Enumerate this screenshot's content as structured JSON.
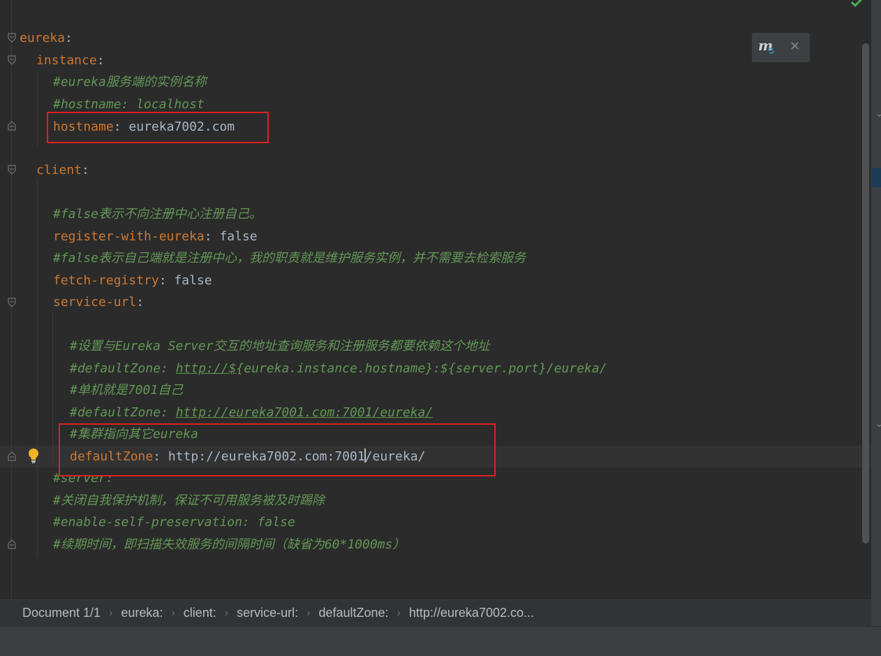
{
  "editor": {
    "lines": [
      {
        "segments": [
          {
            "cls": "k",
            "text": "eureka"
          },
          {
            "cls": "p",
            "text": ":"
          }
        ]
      },
      {
        "segments": [
          {
            "cls": "k",
            "text": "instance"
          },
          {
            "cls": "p",
            "text": ":"
          }
        ]
      },
      {
        "segments": [
          {
            "cls": "c",
            "text": "#eureka服务端的实例名称"
          }
        ]
      },
      {
        "segments": [
          {
            "cls": "c",
            "text": "#hostname: localhost"
          }
        ]
      },
      {
        "segments": [
          {
            "cls": "k",
            "text": "hostname"
          },
          {
            "cls": "p",
            "text": ": "
          },
          {
            "cls": "v",
            "text": "eureka7002.com"
          }
        ]
      },
      {
        "segments": []
      },
      {
        "segments": [
          {
            "cls": "k",
            "text": "client"
          },
          {
            "cls": "p",
            "text": ":"
          }
        ]
      },
      {
        "segments": []
      },
      {
        "segments": [
          {
            "cls": "c",
            "text": "#false表示不向注册中心注册自己。"
          }
        ]
      },
      {
        "segments": [
          {
            "cls": "k",
            "text": "register-with-eureka"
          },
          {
            "cls": "p",
            "text": ": "
          },
          {
            "cls": "v",
            "text": "false"
          }
        ]
      },
      {
        "segments": [
          {
            "cls": "c",
            "text": "#false表示自己端就是注册中心，我的职责就是维护服务实例，并不需要去检索服务"
          }
        ]
      },
      {
        "segments": [
          {
            "cls": "k",
            "text": "fetch-registry"
          },
          {
            "cls": "p",
            "text": ": "
          },
          {
            "cls": "v",
            "text": "false"
          }
        ]
      },
      {
        "segments": [
          {
            "cls": "k",
            "text": "service-url"
          },
          {
            "cls": "p",
            "text": ":"
          }
        ]
      },
      {
        "segments": []
      },
      {
        "segments": [
          {
            "cls": "c",
            "text": "#设置与Eureka Server交互的地址查询服务和注册服务都要依赖这个地址"
          }
        ]
      },
      {
        "segments": [
          {
            "cls": "c",
            "text": "#defaultZone: "
          },
          {
            "cls": "c u",
            "text": "http://$"
          },
          {
            "cls": "c",
            "text": "{eureka.instance.hostname}:${server.port}/eureka/"
          }
        ]
      },
      {
        "segments": [
          {
            "cls": "c",
            "text": "#单机就是7001自己"
          }
        ]
      },
      {
        "segments": [
          {
            "cls": "c",
            "text": "#defaultZone: "
          },
          {
            "cls": "c u",
            "text": "http://eureka7001.com:7001/eureka/"
          }
        ]
      },
      {
        "segments": [
          {
            "cls": "c",
            "text": "#集群指向其它eureka"
          }
        ]
      },
      {
        "segments": [
          {
            "cls": "k",
            "text": "defaultZone"
          },
          {
            "cls": "p",
            "text": ": "
          },
          {
            "cls": "v",
            "text": "http://eureka7002.com:7001"
          },
          {
            "cls": "caret",
            "text": ""
          },
          {
            "cls": "v",
            "text": "/eureka/"
          }
        ]
      },
      {
        "segments": [
          {
            "cls": "c",
            "text": "#server:"
          }
        ]
      },
      {
        "segments": [
          {
            "cls": "c",
            "text": "#关闭自我保护机制，保证不可用服务被及时踢除"
          }
        ]
      },
      {
        "segments": [
          {
            "cls": "c",
            "text": "#enable-self-preservation: false"
          }
        ]
      },
      {
        "segments": [
          {
            "cls": "c",
            "text": "#续期时间，即扫描失效服务的间隔时间（缺省为60*1000ms）"
          }
        ]
      }
    ]
  },
  "breadcrumb": {
    "items": [
      "Document 1/1",
      "eureka:",
      "client:",
      "service-url:",
      "defaultZone:",
      "http://eureka7002.co..."
    ],
    "separator": "›"
  },
  "popup": {
    "icon": "maven-sync-icon",
    "close": "×"
  },
  "status": {
    "icon": "check-icon",
    "color": "#4caf50"
  },
  "colors": {
    "key": "#cc7832",
    "value": "#a9b7c6",
    "comment": "#629755",
    "highlight_box": "#e02020"
  }
}
